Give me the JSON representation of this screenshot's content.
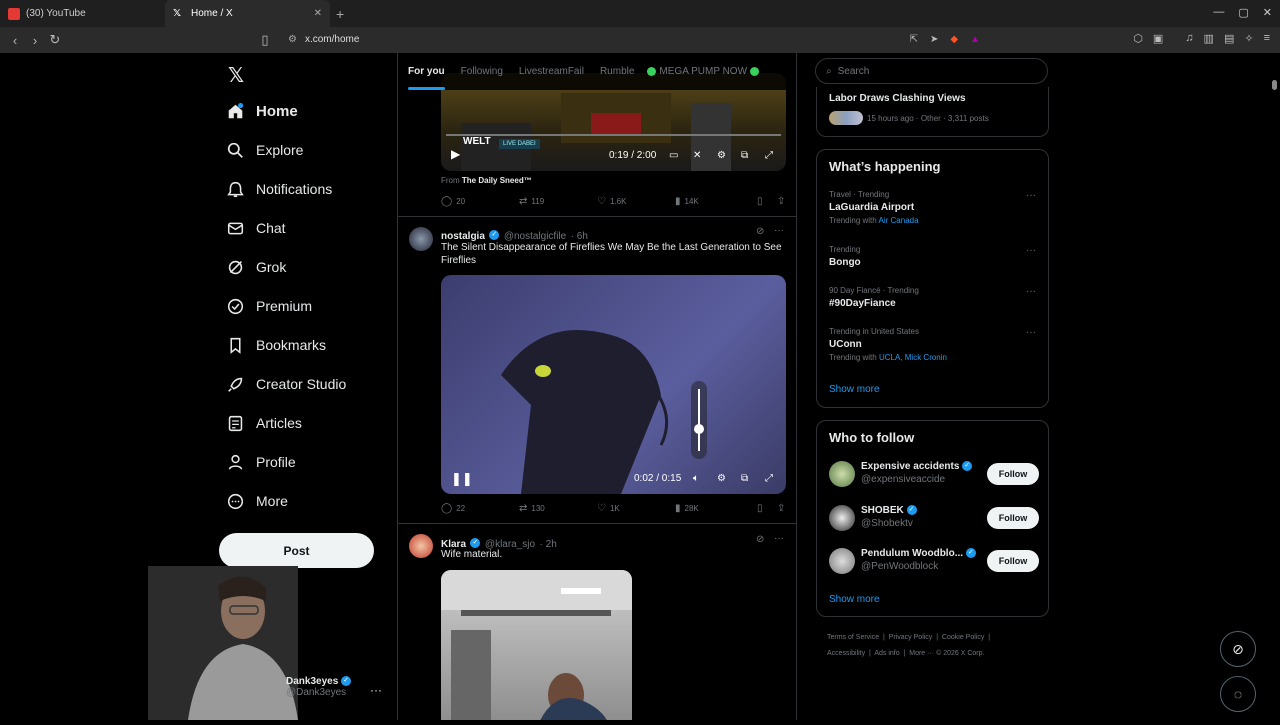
{
  "browser": {
    "tabs": [
      {
        "title": "(30) YouTube",
        "favicon_color": "#e53935"
      },
      {
        "title": "Home / X",
        "favicon_color": "#ffffff"
      }
    ],
    "url": "x.com/home"
  },
  "sidebar": {
    "items": [
      {
        "label": "Home",
        "icon": "home-icon"
      },
      {
        "label": "Explore",
        "icon": "search-icon"
      },
      {
        "label": "Notifications",
        "icon": "bell-icon"
      },
      {
        "label": "Chat",
        "icon": "mail-icon"
      },
      {
        "label": "Grok",
        "icon": "grok-icon"
      },
      {
        "label": "Premium",
        "icon": "premium-icon"
      },
      {
        "label": "Bookmarks",
        "icon": "bookmark-icon"
      },
      {
        "label": "Creator Studio",
        "icon": "rocket-icon"
      },
      {
        "label": "Articles",
        "icon": "article-icon"
      },
      {
        "label": "Profile",
        "icon": "person-icon"
      },
      {
        "label": "More",
        "icon": "more-icon"
      }
    ],
    "post_label": "Post",
    "account": {
      "name": "Dank3eyes",
      "handle": "@Dank3eyes"
    }
  },
  "feed": {
    "tabs": [
      "For you",
      "Following",
      "LivestreamFail",
      "Rumble",
      "MEGA PUMP NOW"
    ],
    "post1": {
      "video_label": "WELT",
      "video_badge": "LIVE DABEI",
      "video_time": "0:19 / 2:00",
      "from_prefix": "From",
      "from_name": "The Daily Sneed™",
      "replies": "20",
      "reposts": "119",
      "likes": "1.6K",
      "views": "14K"
    },
    "post2": {
      "name": "nostalgia",
      "handle": "@nostalgicfile",
      "time": "· 6h",
      "text": "The Silent Disappearance of Fireflies We May Be the Last Generation to See Fireflies",
      "video_time": "0:02 / 0:15",
      "volume_level": 0.35,
      "replies": "22",
      "reposts": "130",
      "likes": "1K",
      "views": "28K"
    },
    "post3": {
      "name": "Klara",
      "handle": "@klara_sjo",
      "time": "· 2h",
      "text": "Wife material."
    }
  },
  "right": {
    "search_placeholder": "Search",
    "top_partial": {
      "title": "Labor Draws Clashing Views",
      "meta": "15 hours ago · Other · 3,311 posts"
    },
    "happening_title": "What’s happening",
    "trends": [
      {
        "meta": "Travel · Trending",
        "title": "LaGuardia Airport",
        "sub_prefix": "Trending with",
        "sub_links": "Air Canada"
      },
      {
        "meta": "Trending",
        "title": "Bongo",
        "sub_prefix": "",
        "sub_links": ""
      },
      {
        "meta": "90 Day Fiancé · Trending",
        "title": "#90DayFiance",
        "sub_prefix": "",
        "sub_links": ""
      },
      {
        "meta": "Trending in United States",
        "title": "UConn",
        "sub_prefix": "Trending with",
        "sub_links": "UCLA, Mick Cronin"
      }
    ],
    "show_more": "Show more",
    "wtf_title": "Who to follow",
    "follow_label": "Follow",
    "wtf": [
      {
        "name": "Expensive accidents",
        "handle": "@expensiveaccide"
      },
      {
        "name": "SHOBEK",
        "handle": "@Shobektv"
      },
      {
        "name": "Pendulum Woodblo...",
        "handle": "@PenWoodblock"
      }
    ],
    "footer": [
      "Terms of Service",
      "Privacy Policy",
      "Cookie Policy",
      "Accessibility",
      "Ads info",
      "More ···",
      "© 2026 X Corp."
    ]
  }
}
